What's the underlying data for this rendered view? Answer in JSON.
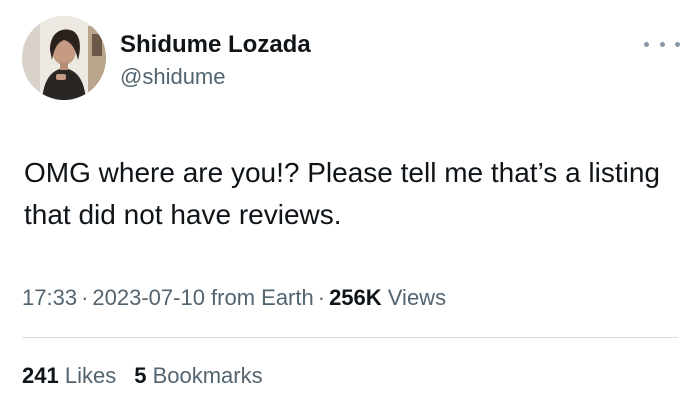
{
  "author": {
    "name": "Shidume Lozada",
    "handle": "@shidume",
    "avatar_icon": "profile-photo"
  },
  "more_icon": "ellipsis-icon",
  "tweet": {
    "text": "OMG where are you!? Please tell me that’s a listing that did not have reviews."
  },
  "meta": {
    "time": "17:33",
    "separator": "·",
    "date": "2023-07-10 from Earth",
    "views_count": "256K",
    "views_label": "Views"
  },
  "stats": {
    "likes_count": "241",
    "likes_label": "Likes",
    "bookmarks_count": "5",
    "bookmarks_label": "Bookmarks"
  },
  "colors": {
    "text_primary": "#0f1419",
    "text_secondary": "#536471",
    "divider": "#d5dbe0",
    "background": "#ffffff"
  }
}
